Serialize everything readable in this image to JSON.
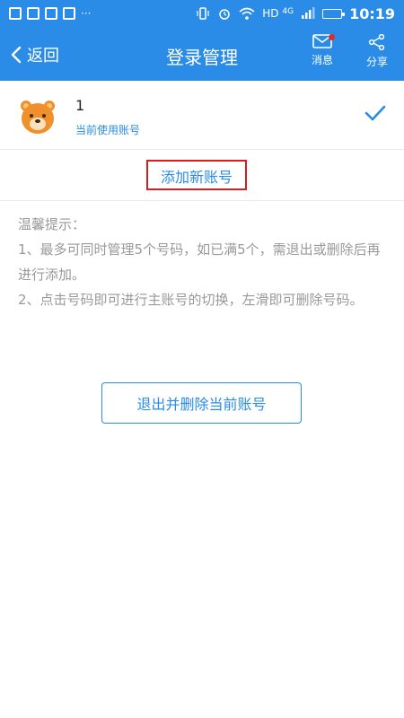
{
  "status_bar": {
    "network": "HD",
    "network_gen": "4G",
    "time": "10:19",
    "more": "···"
  },
  "header": {
    "back_label": "返回",
    "title": "登录管理",
    "message_label": "消息",
    "share_label": "分享",
    "accent_color": "#2a8ce6",
    "badge_color": "#e12a2a"
  },
  "account": {
    "name": "1",
    "status": "当前使用账号",
    "avatar_icon": "bear-avatar-icon",
    "check_icon": "check-icon"
  },
  "add_account": {
    "label": "添加新账号",
    "highlight_color": "#d41f1f"
  },
  "tips": {
    "title": "温馨提示：",
    "item1": "1、最多可同时管理5个号码，如已满5个，需退出或删除后再进行添加。",
    "item2": "2、点击号码即可进行主账号的切换，左滑即可删除号码。"
  },
  "logout": {
    "label": "退出并删除当前账号"
  }
}
